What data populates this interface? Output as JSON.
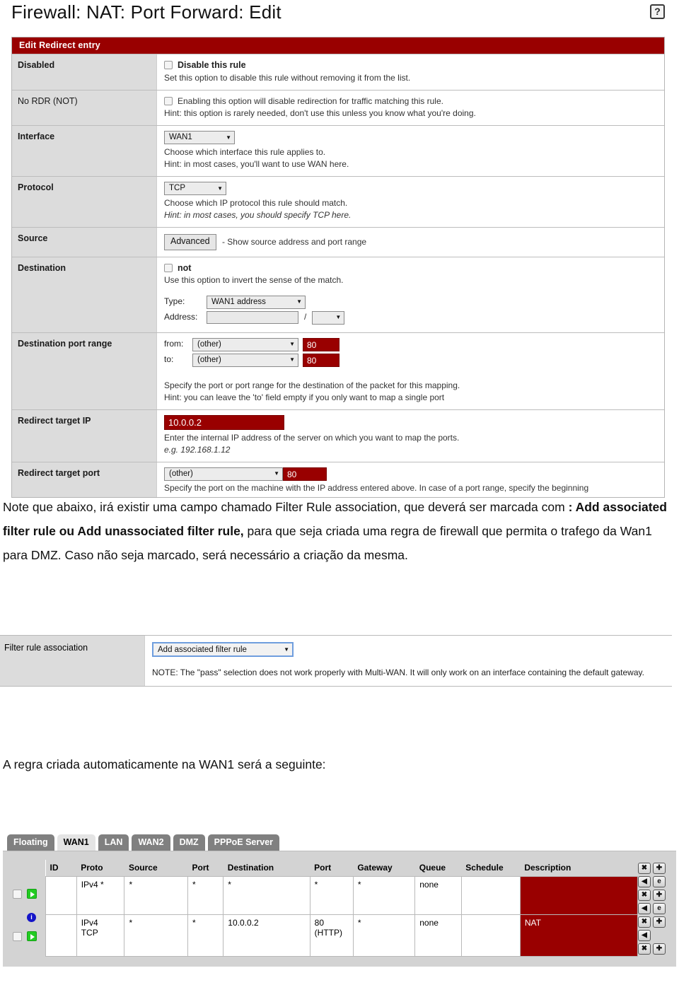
{
  "doc": {
    "title": "Firewall: NAT: Port Forward: Edit",
    "help_icon": "question-mark-icon"
  },
  "form": {
    "panel_header": "Edit Redirect entry",
    "rows": [
      {
        "label": "Disabled",
        "checkbox_label": "Disable this rule",
        "desc1": "Set this option to disable this rule without removing it from the list."
      },
      {
        "label": "No RDR (NOT)",
        "desc1": "Enabling this option will disable redirection for traffic matching this rule.",
        "desc2": "Hint: this option is rarely needed, don't use this unless you know what you're doing."
      },
      {
        "label": "Interface",
        "select_value": "WAN1",
        "desc1": "Choose which interface this rule applies to.",
        "desc2": "Hint: in most cases, you'll want to use WAN here."
      },
      {
        "label": "Protocol",
        "select_value": "TCP",
        "desc1": "Choose which IP protocol this rule should match.",
        "desc2": "Hint: in most cases, you should specify TCP here."
      },
      {
        "label": "Source",
        "button_label": "Advanced",
        "desc1": "- Show source address and port range"
      },
      {
        "label": "Destination",
        "checkbox_label": "not",
        "desc1": "Use this option to invert the sense of the match.",
        "type_label": "Type:",
        "type_value": "WAN1 address",
        "address_label": "Address:",
        "address_value": "",
        "address_sep": "/",
        "mask_value": ""
      },
      {
        "label": "Destination port range",
        "from_label": "from:",
        "from_select": "(other)",
        "from_value": "80",
        "to_label": "to:",
        "to_select": "(other)",
        "to_value": "80",
        "desc1": "Specify the port or port range for the destination of the packet for this mapping.",
        "desc2": "Hint: you can leave the 'to' field empty if you only want to map a single port"
      },
      {
        "label": "Redirect target IP",
        "value": "10.0.0.2",
        "desc1": "Enter the internal IP address of the server on which you want to map the ports.",
        "desc2": "e.g. 192.168.1.12"
      },
      {
        "label": "Redirect target port",
        "select_value": "(other)",
        "value": "80",
        "desc1": "Specify the port on the machine with the IP address entered above. In case of a port range, specify the beginning"
      }
    ]
  },
  "prose": {
    "p1_a": "Note que abaixo, irá existir uma campo chamado Filter Rule association, que deverá ser marcada com ",
    "p1_b": ": Add associated filter rule ou Add unassociated filter rule,",
    "p1_c": " para que seja criada uma regra de firewall que permita o trafego da Wan1 para DMZ. Caso não seja marcado, será necessário a criação da mesma.",
    "p2": "A regra criada automaticamente na WAN1 será a seguinte:"
  },
  "filter_rule_association": {
    "label": "Filter rule association",
    "select_value": "Add associated filter rule",
    "note": "NOTE: The \"pass\" selection does not work properly with Multi-WAN. It will only work on an interface containing the default gateway."
  },
  "rules": {
    "tabs": [
      {
        "label": "Floating",
        "active": false
      },
      {
        "label": "WAN1",
        "active": true
      },
      {
        "label": "LAN",
        "active": false
      },
      {
        "label": "WAN2",
        "active": false
      },
      {
        "label": "DMZ",
        "active": false
      },
      {
        "label": "PPPoE Server",
        "active": false
      }
    ],
    "columns": [
      "ID",
      "Proto",
      "Source",
      "Port",
      "Destination",
      "Port",
      "Gateway",
      "Queue",
      "Schedule",
      "Description"
    ],
    "rows": [
      {
        "state": "pass",
        "id": "",
        "proto": "IPv4 *",
        "source": "*",
        "port": "*",
        "destination": "*",
        "dport": "*",
        "gateway": "*",
        "queue": "none",
        "schedule": "",
        "description": ""
      },
      {
        "state": "pass",
        "id": "",
        "proto": "IPv4 TCP",
        "source": "*",
        "port": "*",
        "destination": "10.0.0.2",
        "dport": "80 (HTTP)",
        "gateway": "*",
        "queue": "none",
        "schedule": "",
        "description": "NAT"
      }
    ],
    "action_icons": [
      "delete-icon",
      "add-icon",
      "move-icon",
      "edit-icon"
    ]
  },
  "colors": {
    "accent_red": "#990000",
    "label_gray": "#dcdcdc",
    "tab_gray": "#808080"
  }
}
